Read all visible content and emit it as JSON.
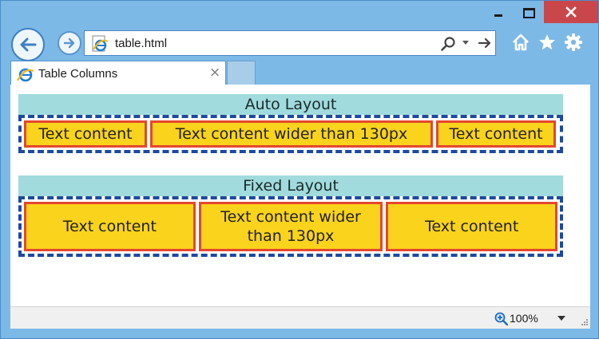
{
  "address_bar": {
    "url": "table.html"
  },
  "tabs": [
    {
      "title": "Table Columns",
      "close_glyph": "×"
    }
  ],
  "icons": {
    "back": "back-arrow-icon",
    "forward": "forward-arrow-icon",
    "page": "ie-page-icon",
    "search": "search-icon",
    "dropdown": "chevron-down-icon",
    "go": "go-arrow-icon",
    "home": "home-icon",
    "favorites": "star-icon",
    "tools": "gear-icon",
    "minimize": "minimize-icon",
    "maximize": "maximize-icon",
    "close": "close-icon",
    "zoom": "zoom-icon"
  },
  "content": {
    "auto_layout": {
      "caption": "Auto Layout",
      "cells": [
        "Text content",
        "Text content wider than 130px",
        "Text content"
      ]
    },
    "fixed_layout": {
      "caption": "Fixed Layout",
      "cells": [
        "Text content",
        "Text content wider than 130px",
        "Text content"
      ]
    }
  },
  "statusbar": {
    "zoom": "100%"
  },
  "colors": {
    "window_frame": "#7db9e6",
    "close_button": "#c9474a",
    "caption_bg": "#a1dbdd",
    "cell_bg": "#f9d31c",
    "cell_border": "#e5472e",
    "table_border": "#1d4aa0"
  }
}
